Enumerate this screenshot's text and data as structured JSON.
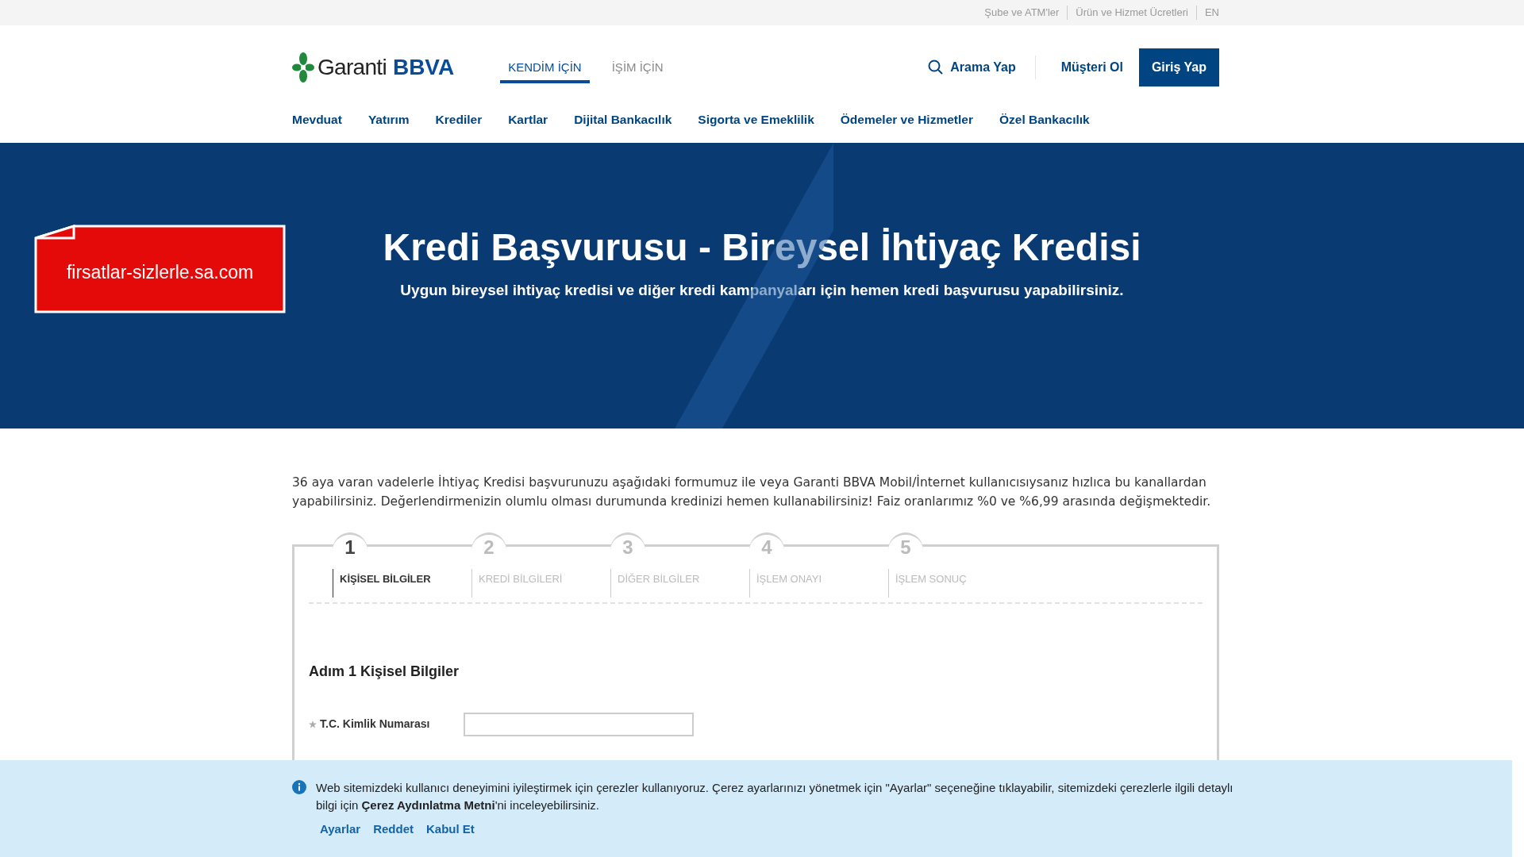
{
  "top_links": [
    "Şube ve ATM'ler",
    "Ürün ve Hizmet Ücretleri",
    "EN"
  ],
  "header": {
    "logo_text": "Garanti",
    "logo_brand": "BBVA",
    "segments": [
      {
        "label": "KENDİM İÇİN",
        "selected": true
      },
      {
        "label": "İŞİM İÇİN",
        "selected": false
      }
    ],
    "search": "Arama Yap",
    "signup": "Müşteri Ol",
    "login": "Giriş Yap"
  },
  "nav": [
    "Mevduat",
    "Yatırım",
    "Krediler",
    "Kartlar",
    "Dijital Bankacılık",
    "Sigorta ve Emeklilik",
    "Ödemeler ve Hizmetler",
    "Özel Bankacılık"
  ],
  "sticker": "firsatlar-sizlerle.sa.com",
  "hero": {
    "title": "Kredi Başvurusu - Bireysel İhtiyaç Kredisi",
    "subtitle": "Uygun bireysel ihtiyaç kredisi ve diğer kredi kampanyaları için hemen kredi başvurusu yapabilirsiniz."
  },
  "intro": "36 aya varan vadelerle İhtiyaç Kredisi başvurunuzu aşağıdaki formumuz ile veya Garanti BBVA Mobil/İnternet kullanıcısıysanız hızlıca bu kanallardan yapabilirsiniz. Değerlendirmenizin olumlu olması durumunda kredinizi hemen kullanabilirsiniz! Faiz oranlarımız %0 ve %6,99 arasında değişmektedir.",
  "steps": [
    {
      "number": "1",
      "label": "KİŞİSEL BİLGİLER",
      "selected": true
    },
    {
      "number": "2",
      "label": "KREDİ BİLGİLERİ",
      "selected": false
    },
    {
      "number": "3",
      "label": "DİĞER BİLGİLER",
      "selected": false
    },
    {
      "number": "4",
      "label": "İŞLEM ONAYI",
      "selected": false
    },
    {
      "number": "5",
      "label": "İŞLEM SONUÇ",
      "selected": false
    }
  ],
  "form": {
    "title": "Adım 1 Kişisel Bilgiler",
    "fields": [
      {
        "label": "T.C. Kimlik Numarası",
        "required": true
      }
    ]
  },
  "cookie": {
    "text": "Web sitemizdeki kullanıcı deneyimini iyileştirmek için çerezler kullanıyoruz. Çerez ayarlarınızı yönetmek için \"Ayarlar\" seçeneğine tıklayabilir, sitemizdeki çerezlerle ilgili detaylı bilgi için **Çerez Aydınlatma Metni**'ni inceleyebilirsiniz.",
    "actions": [
      "Ayarlar",
      "Reddet",
      "Kabul Et"
    ]
  }
}
